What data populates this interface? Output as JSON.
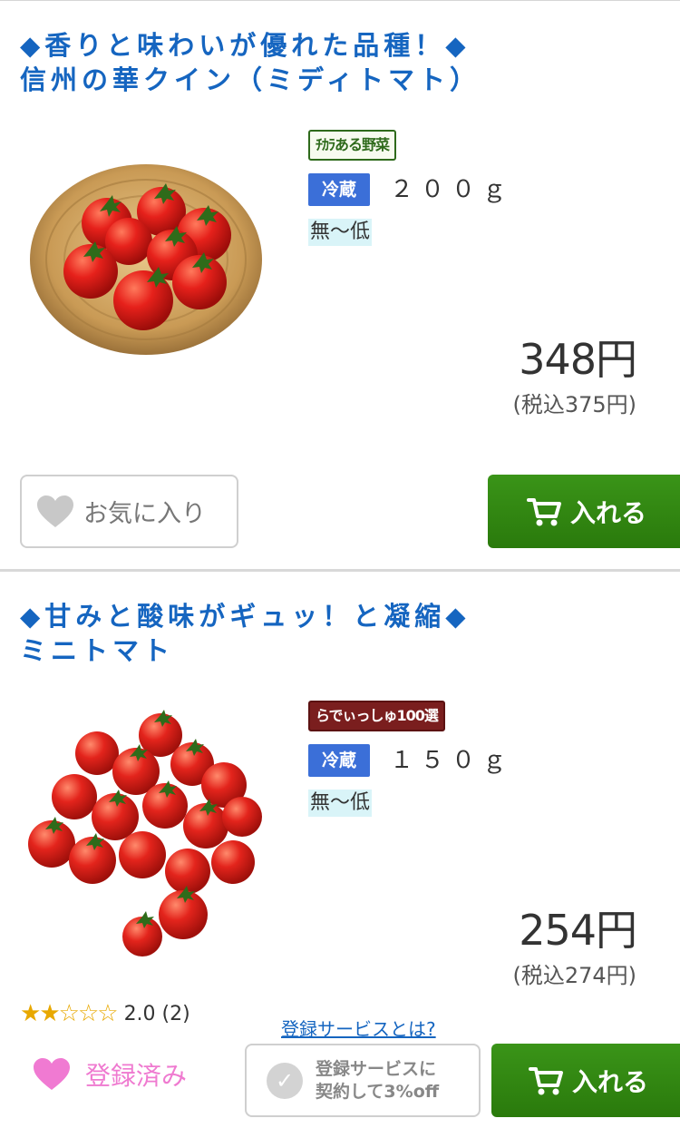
{
  "products": [
    {
      "title_line1": "◆香りと味わいが優れた品種！◆",
      "title_line2": "信州の華クイン（ミディトマト）",
      "brand_badge": "ﾁｶﾗある野菜",
      "storage": "冷蔵",
      "weight": "２００ｇ",
      "pesticide": "無～低",
      "price": "348円",
      "price_tax": "(税込375円)",
      "favorite_label": "お気に入り",
      "cart_label": "入れる"
    },
    {
      "title_line1": "◆甘みと酸味がギュッ！と凝縮◆",
      "title_line2": "ミニトマト",
      "brand_badge": "らでぃっしゅ100選",
      "storage": "冷蔵",
      "weight": "１５０ｇ",
      "pesticide": "無～低",
      "price": "254円",
      "price_tax": "(税込274円)",
      "rating_stars_filled": 2,
      "rating_stars_total": 5,
      "rating_text": "2.0 (2)",
      "register_link": "登録サービスとは?",
      "favorite_label": "登録済み",
      "service_label_line1": "登録サービスに",
      "service_label_line2": "契約して3%off",
      "cart_label": "入れる"
    }
  ],
  "colors": {
    "title": "#1565c0",
    "cart_button": "#2a7a0c",
    "storage_badge": "#3b6fd8",
    "registered_pink": "#ef7ad0"
  }
}
